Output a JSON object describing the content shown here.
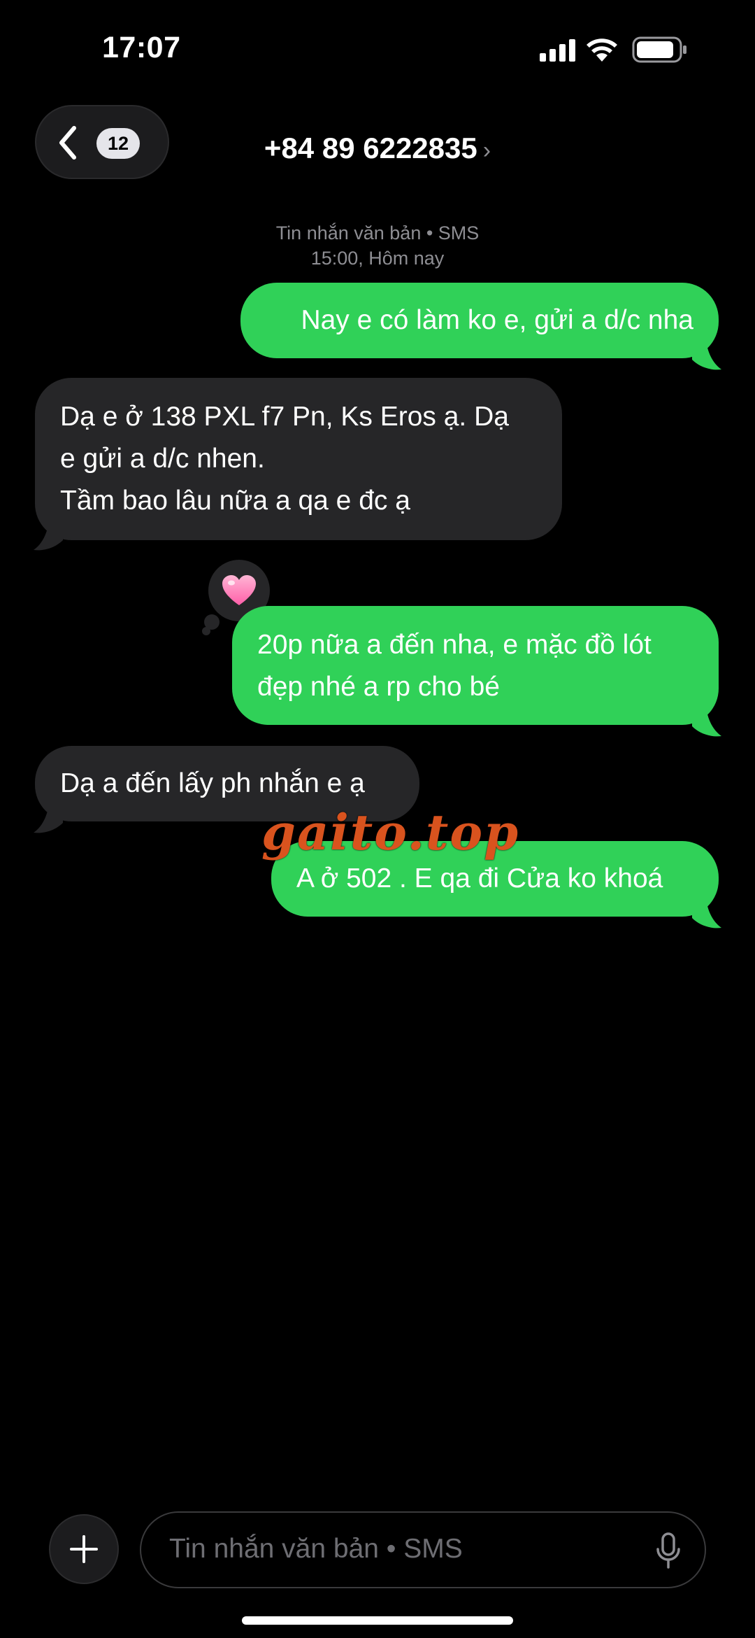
{
  "status_bar": {
    "time": "17:07",
    "signal_icon": "cellular-signal",
    "wifi_icon": "wifi",
    "battery_icon": "battery"
  },
  "header": {
    "back_icon": "chevron-left",
    "unread_count": "12",
    "contact": "+84 89 6222835",
    "contact_chevron": "›"
  },
  "thread_meta": {
    "line1": "Tin nhắn văn bản • SMS",
    "line2": "15:00, Hôm nay"
  },
  "messages": [
    {
      "direction": "outgoing",
      "text": "Nay e có làm ko e, gửi a d/c nha"
    },
    {
      "direction": "incoming",
      "text": "Dạ e ở 138 PXL f7 Pn, Ks Eros ạ. Dạ\ne gửi a d/c nhen.\nTầm bao lâu nữa a qa e đc ạ"
    },
    {
      "direction": "outgoing",
      "text": "20p nữa a đến nha, e mặc đồ lót\nđẹp nhé a rp cho bé",
      "tapback": "💗"
    },
    {
      "direction": "incoming",
      "text": "Dạ a đến lấy ph nhắn e ạ"
    },
    {
      "direction": "outgoing",
      "text": "A ở 502 . E qa đi Cửa ko khoá"
    }
  ],
  "watermark": "gaito.top",
  "composer": {
    "add_icon": "plus",
    "placeholder": "Tin nhắn văn bản • SMS",
    "mic_icon": "microphone"
  },
  "colors": {
    "outgoing_bubble": "#30d158",
    "incoming_bubble": "#262628",
    "background": "#000000",
    "watermark": "#d9531e"
  }
}
